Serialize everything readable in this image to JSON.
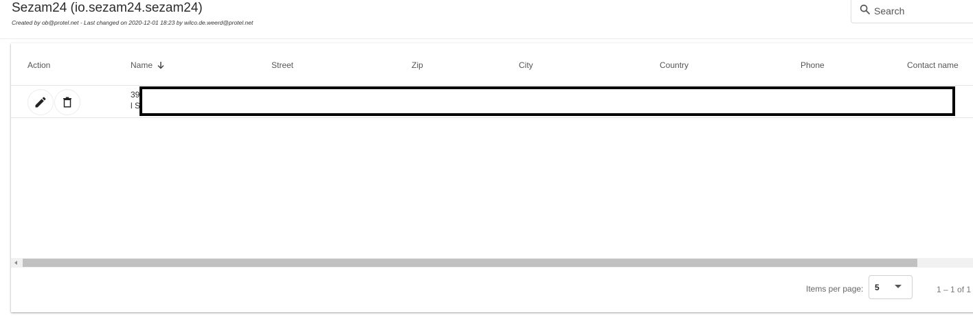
{
  "header": {
    "title": "Sezam24 (io.sezam24.sezam24)",
    "subtitle": "Created by ob@protel.net - Last changed on 2020-12-01 18:23 by wilco.de.weerd@protel.net",
    "search_placeholder": "Search"
  },
  "table": {
    "columns": {
      "action": "Action",
      "name": "Name",
      "street": "Street",
      "zip": "Zip",
      "city": "City",
      "country": "Country",
      "phone": "Phone",
      "contact_name": "Contact name"
    },
    "sorted_column": "Name",
    "sort_direction": "descending",
    "rows": [
      {
        "name_line1": "39",
        "name_line2": "l S",
        "redacted": true
      }
    ]
  },
  "paginator": {
    "items_per_page_label": "Items per page:",
    "items_per_page_value": "5",
    "range_label": "1 – 1 of 1"
  },
  "icons": [
    "search-icon",
    "sort-arrow-down-icon",
    "edit-pencil-icon",
    "delete-trash-icon",
    "scroll-left-arrow-icon",
    "dropdown-caret-icon"
  ]
}
